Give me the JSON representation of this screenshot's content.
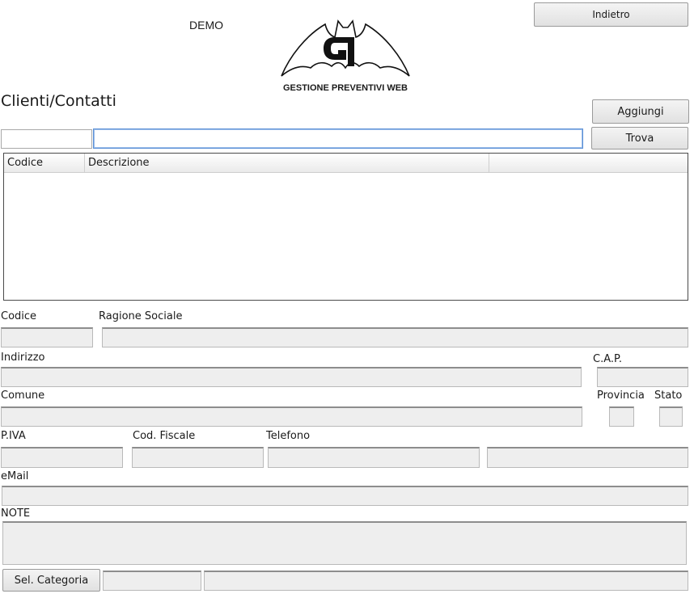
{
  "header": {
    "demo_label": "DEMO",
    "logo_caption": "GESTIONE PREVENTIVI WEB",
    "back_button": "Indietro"
  },
  "page": {
    "title": "Clienti/Contatti",
    "add_button": "Aggiungi",
    "find_button": "Trova"
  },
  "search": {
    "code_value": "",
    "text_value": ""
  },
  "grid": {
    "columns": [
      "Codice",
      "Descrizione",
      ""
    ]
  },
  "form": {
    "codice": "Codice",
    "ragione_sociale": "Ragione Sociale",
    "indirizzo": "Indirizzo",
    "cap": "C.A.P.",
    "comune": "Comune",
    "provincia": "Provincia",
    "stato": "Stato",
    "piva": "P.IVA",
    "cod_fiscale": "Cod. Fiscale",
    "telefono": "Telefono",
    "email": "eMail",
    "note": "NOTE",
    "sel_categoria": "Sel. Categoria"
  }
}
